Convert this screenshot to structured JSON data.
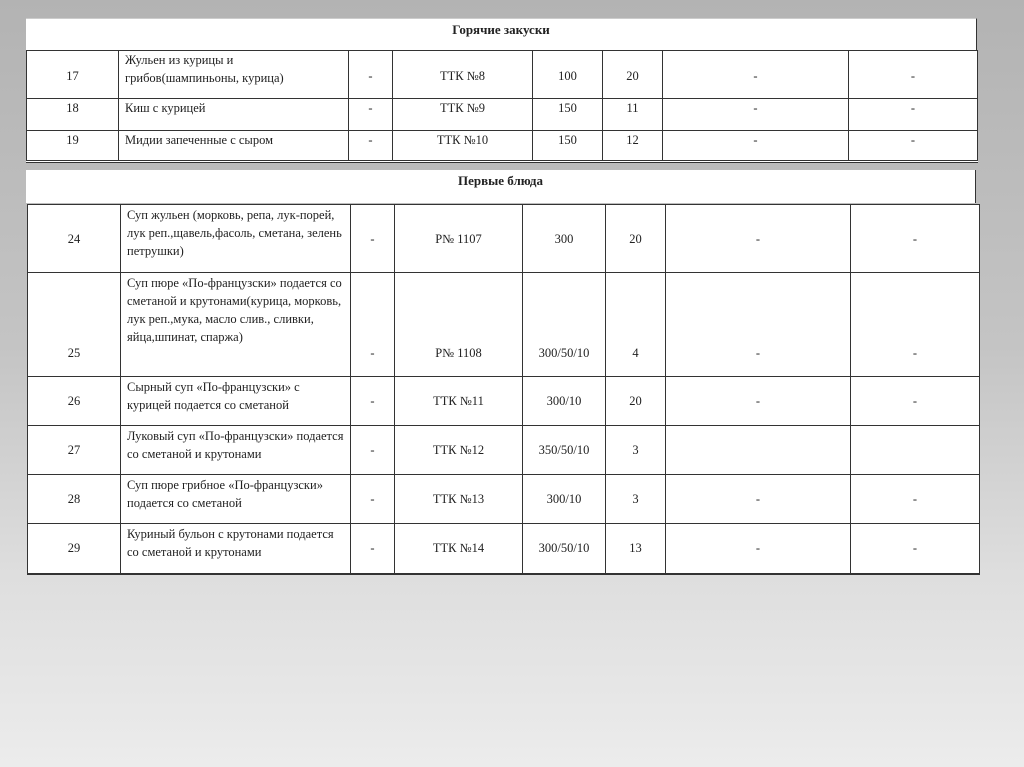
{
  "sections": [
    {
      "title": "Горячие закуски",
      "rows": [
        {
          "num": "17",
          "name": "Жульен из курицы и грибов(шампиньоны, курица)",
          "c3": "-",
          "tech": "ТТК №8",
          "yield": "100",
          "qty": "20",
          "c7": "-",
          "c8": "-"
        },
        {
          "num": "18",
          "name": "Киш с курицей",
          "c3": "-",
          "tech": "ТТК №9",
          "yield": "150",
          "qty": "11",
          "c7": "-",
          "c8": "-"
        },
        {
          "num": "19",
          "name": "Мидии запеченные с сыром",
          "c3": "-",
          "tech": "ТТК №10",
          "yield": "150",
          "qty": "12",
          "c7": "-",
          "c8": "-"
        }
      ]
    },
    {
      "title": "Первые блюда",
      "rows": [
        {
          "num": "24",
          "name": "Суп жульен (морковь, репа, лук-порей, лук реп.,щавель,фасоль, сметана, зелень петрушки)",
          "c3": "-",
          "tech": "Р№ 1107",
          "yield": "300",
          "qty": "20",
          "c7": "-",
          "c8": "-"
        },
        {
          "num": "25",
          "name": "Суп пюре «По-французски» подается со сметаной и крутонами(курица, морковь, лук реп.,мука, масло слив., сливки, яйца,шпинат, спаржа)",
          "c3": "-",
          "tech": "Р№ 1108",
          "yield": "300/50/10",
          "qty": "4",
          "c7": "-",
          "c8": "-"
        },
        {
          "num": "26",
          "name": "Сырный суп «По-французски» с курицей подается со сметаной",
          "c3": "-",
          "tech": "ТТК №11",
          "yield": "300/10",
          "qty": "20",
          "c7": "-",
          "c8": "-"
        },
        {
          "num": "27",
          "name": "Луковый суп «По-французски» подается со сметаной и крутонами",
          "c3": "-",
          "tech": "ТТК №12",
          "yield": "350/50/10",
          "qty": "3",
          "c7": "",
          "c8": ""
        },
        {
          "num": "28",
          "name": "Суп пюре грибное «По-французски» подается со сметаной",
          "c3": "-",
          "tech": "ТТК №13",
          "yield": "300/10",
          "qty": "3",
          "c7": "-",
          "c8": "-"
        },
        {
          "num": "29",
          "name": "Куриный бульон с крутонами подается со сметаной и крутонами",
          "c3": "-",
          "tech": "ТТК №14",
          "yield": "300/50/10",
          "qty": "13",
          "c7": "-",
          "c8": "-"
        }
      ]
    }
  ]
}
